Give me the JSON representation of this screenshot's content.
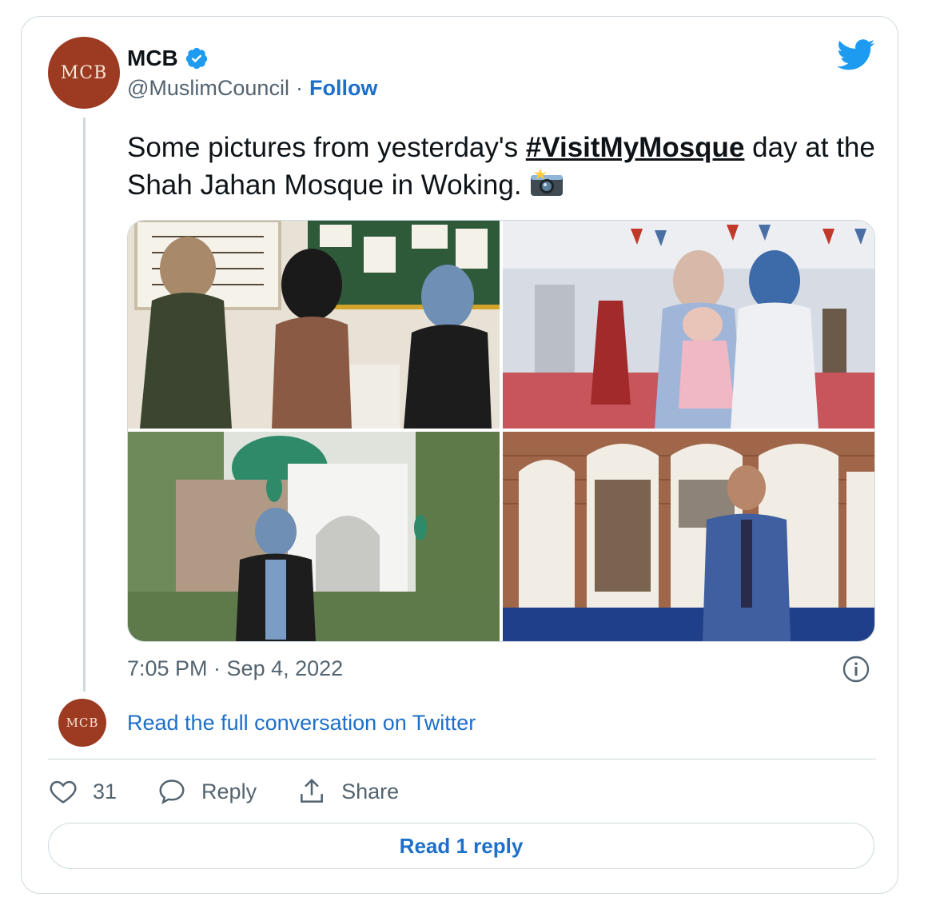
{
  "author": {
    "avatar_text": "MCB",
    "display_name": "MCB",
    "handle": "@MuslimCouncil",
    "separator": "·",
    "follow_label": "Follow"
  },
  "tweet": {
    "text_before": "Some pictures from yesterday's ",
    "hashtag": "#VisitMyMosque",
    "text_after": " day at the Shah Jahan Mosque in Woking. ",
    "timestamp": "7:05 PM · Sep 4, 2022"
  },
  "conversation": {
    "link_label": "Read the full conversation on Twitter"
  },
  "actions": {
    "likes_count": "31",
    "reply_label": "Reply",
    "share_label": "Share"
  },
  "footer": {
    "read_replies_label": "Read 1 reply"
  },
  "colors": {
    "accent": "#1d6fc9",
    "avatar_bg": "#9c3a22",
    "verified": "#1d9bf0",
    "border": "#cfd9de",
    "muted": "#536471"
  },
  "icons": [
    "verified-badge-icon",
    "twitter-bird-icon",
    "camera-flash-icon",
    "info-icon",
    "heart-icon",
    "reply-bubble-icon",
    "share-icon"
  ]
}
